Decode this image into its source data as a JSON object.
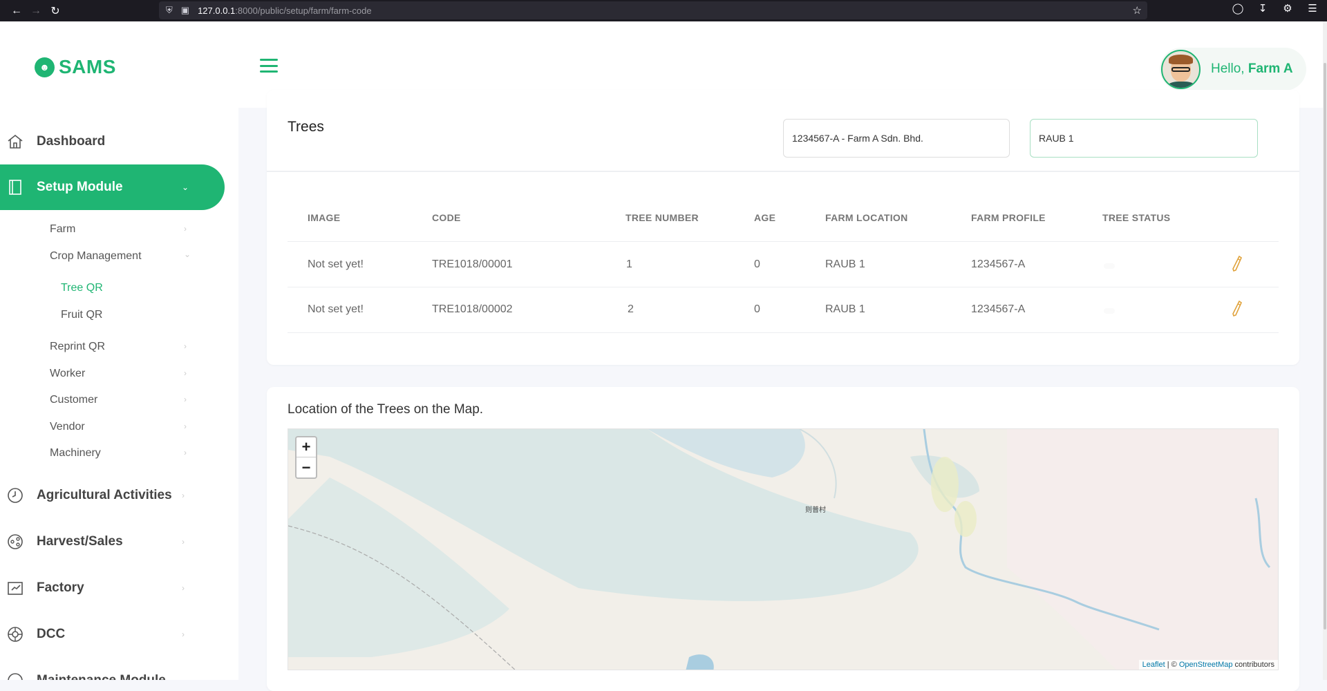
{
  "browser": {
    "url_host": "127.0.0.1",
    "url_path": ":8000/public/setup/farm/farm-code"
  },
  "header": {
    "logo_text": "SAMS",
    "greeting": "Hello, ",
    "user_name": "Farm A"
  },
  "sidebar": {
    "items": [
      {
        "label": "Dashboard",
        "icon": "home-icon"
      },
      {
        "label": "Setup Module",
        "icon": "book-icon",
        "active": true
      },
      {
        "label": "Agricultural Activities",
        "icon": "clock-icon"
      },
      {
        "label": "Harvest/Sales",
        "icon": "share-icon"
      },
      {
        "label": "Factory",
        "icon": "factory-icon"
      },
      {
        "label": "DCC",
        "icon": "globe-icon"
      },
      {
        "label": "Maintenance Module",
        "icon": "tool-icon"
      }
    ],
    "setup_sub": [
      "Farm",
      "Crop Management",
      "Reprint QR",
      "Worker",
      "Customer",
      "Vendor",
      "Machinery"
    ],
    "crop_sub": [
      "Tree QR",
      "Fruit QR"
    ]
  },
  "trees": {
    "title": "Trees",
    "farm_select": "1234567-A - Farm A Sdn. Bhd.",
    "location_select": "RAUB 1",
    "columns": [
      "IMAGE",
      "CODE",
      "TREE NUMBER",
      "AGE",
      "FARM LOCATION",
      "FARM PROFILE",
      "TREE STATUS"
    ],
    "rows": [
      {
        "image": "Not set yet!",
        "code": "TRE1018/00001",
        "tree_number": "1",
        "age": "0",
        "farm_location": "RAUB 1",
        "farm_profile": "1234567-A"
      },
      {
        "image": "Not set yet!",
        "code": "TRE1018/00002",
        "tree_number": "2",
        "age": "0",
        "farm_location": "RAUB 1",
        "farm_profile": "1234567-A"
      }
    ]
  },
  "map": {
    "title": "Location of the Trees on the Map.",
    "zoom_in": "+",
    "zoom_out": "−",
    "attribution_leaflet": "Leaflet",
    "attribution_sep": " | © ",
    "attribution_osm": "OpenStreetMap",
    "attribution_tail": " contributors",
    "place_label": "则普村"
  },
  "colors": {
    "accent": "#1fb573",
    "edit_icon": "#e0a23b"
  }
}
